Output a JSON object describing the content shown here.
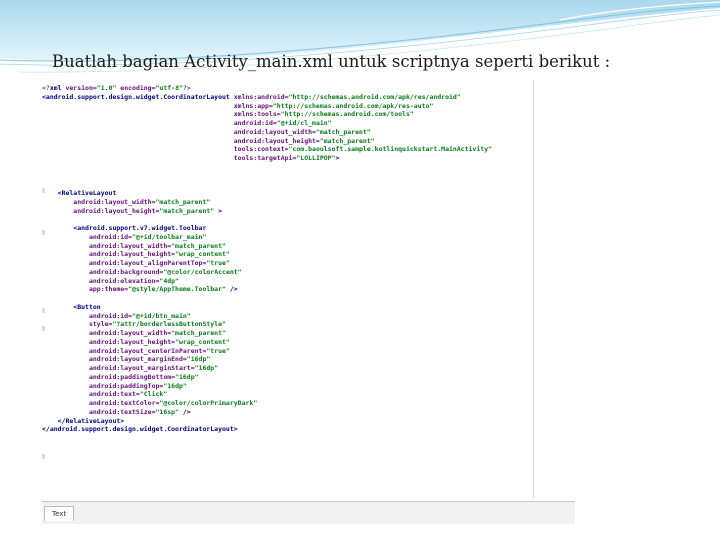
{
  "slide": {
    "title": "Buatlah bagian Activity_main.xml untuk scriptnya seperti berikut :"
  },
  "editor": {
    "bottom_tab_label": "Text",
    "code_lines": [
      [
        {
          "t": "<?",
          "c": "plain"
        },
        {
          "t": "xml ",
          "c": "tag"
        },
        {
          "t": "version=",
          "c": "attr"
        },
        {
          "t": "\"1.0\"",
          "c": "val"
        },
        {
          "t": " encoding=",
          "c": "attr"
        },
        {
          "t": "\"utf-8\"",
          "c": "val"
        },
        {
          "t": "?>",
          "c": "plain"
        }
      ],
      [
        {
          "t": "<android.support.design.widget.CoordinatorLayout ",
          "c": "tag"
        },
        {
          "t": "xmlns:android=",
          "c": "attr"
        },
        {
          "t": "\"http://schemas.android.com/apk/res/android\"",
          "c": "val"
        }
      ],
      [
        {
          "t": "                                                 xmlns:app=",
          "c": "attr"
        },
        {
          "t": "\"http://schemas.android.com/apk/res-auto\"",
          "c": "val"
        }
      ],
      [
        {
          "t": "                                                 xmlns:tools=",
          "c": "attr"
        },
        {
          "t": "\"http://schemas.android.com/tools\"",
          "c": "val"
        }
      ],
      [
        {
          "t": "                                                 android:id=",
          "c": "attr"
        },
        {
          "t": "\"@+id/cl_main\"",
          "c": "val"
        }
      ],
      [
        {
          "t": "                                                 android:layout_width=",
          "c": "attr"
        },
        {
          "t": "\"match_parent\"",
          "c": "val"
        }
      ],
      [
        {
          "t": "                                                 android:layout_height=",
          "c": "attr"
        },
        {
          "t": "\"match_parent\"",
          "c": "val"
        }
      ],
      [
        {
          "t": "                                                 tools:context=",
          "c": "attr"
        },
        {
          "t": "\"com.baoulsoft.sample.kotlinquickstart.MainActivity\"",
          "c": "val"
        }
      ],
      [
        {
          "t": "                                                 tools:targetApi=",
          "c": "attr"
        },
        {
          "t": "\"LOLLIPOP\"",
          "c": "val"
        },
        {
          "t": ">",
          "c": "tag"
        }
      ],
      [],
      [],
      [],
      [
        {
          "t": "    <RelativeLayout",
          "c": "tag"
        }
      ],
      [
        {
          "t": "        android:layout_width=",
          "c": "attr"
        },
        {
          "t": "\"match_parent\"",
          "c": "val"
        }
      ],
      [
        {
          "t": "        android:layout_height=",
          "c": "attr"
        },
        {
          "t": "\"match_parent\"",
          "c": "val"
        },
        {
          "t": " >",
          "c": "tag"
        }
      ],
      [],
      [
        {
          "t": "        <android.support.v7.widget.Toolbar",
          "c": "tag"
        }
      ],
      [
        {
          "t": "            android:id=",
          "c": "attr"
        },
        {
          "t": "\"@+id/toolbar_main\"",
          "c": "val"
        }
      ],
      [
        {
          "t": "            android:layout_width=",
          "c": "attr"
        },
        {
          "t": "\"match_parent\"",
          "c": "val"
        }
      ],
      [
        {
          "t": "            android:layout_height=",
          "c": "attr"
        },
        {
          "t": "\"wrap_content\"",
          "c": "val"
        }
      ],
      [
        {
          "t": "            android:layout_alignParentTop=",
          "c": "attr"
        },
        {
          "t": "\"true\"",
          "c": "val"
        }
      ],
      [
        {
          "t": "            android:background=",
          "c": "attr"
        },
        {
          "t": "\"@color/colorAccent\"",
          "c": "val"
        }
      ],
      [
        {
          "t": "            android:elevation=",
          "c": "attr"
        },
        {
          "t": "\"4dp\"",
          "c": "val"
        }
      ],
      [
        {
          "t": "            app:theme=",
          "c": "attr"
        },
        {
          "t": "\"@style/AppTheme.Toolbar\"",
          "c": "val"
        },
        {
          "t": " />",
          "c": "tag"
        }
      ],
      [],
      [
        {
          "t": "        <Button",
          "c": "tag"
        }
      ],
      [
        {
          "t": "            android:id=",
          "c": "attr"
        },
        {
          "t": "\"@+id/btn_main\"",
          "c": "val"
        }
      ],
      [
        {
          "t": "            style=",
          "c": "attr"
        },
        {
          "t": "\"?attr/borderlessButtonStyle\"",
          "c": "val"
        }
      ],
      [
        {
          "t": "            android:layout_width=",
          "c": "attr"
        },
        {
          "t": "\"match_parent\"",
          "c": "val"
        }
      ],
      [
        {
          "t": "            android:layout_height=",
          "c": "attr"
        },
        {
          "t": "\"wrap_content\"",
          "c": "val"
        }
      ],
      [
        {
          "t": "            android:layout_centerInParent=",
          "c": "attr"
        },
        {
          "t": "\"true\"",
          "c": "val"
        }
      ],
      [
        {
          "t": "            android:layout_marginEnd=",
          "c": "attr"
        },
        {
          "t": "\"16dp\"",
          "c": "val"
        }
      ],
      [
        {
          "t": "            android:layout_marginStart=",
          "c": "attr"
        },
        {
          "t": "\"16dp\"",
          "c": "val"
        }
      ],
      [
        {
          "t": "            android:paddingBottom=",
          "c": "attr"
        },
        {
          "t": "\"16dp\"",
          "c": "val"
        }
      ],
      [
        {
          "t": "            android:paddingTop=",
          "c": "attr"
        },
        {
          "t": "\"16dp\"",
          "c": "val"
        }
      ],
      [
        {
          "t": "            android:text=",
          "c": "attr"
        },
        {
          "t": "\"Click\"",
          "c": "val"
        }
      ],
      [
        {
          "t": "            android:textColor=",
          "c": "attr"
        },
        {
          "t": "\"@color/colorPrimaryDark\"",
          "c": "val"
        }
      ],
      [
        {
          "t": "            android:textSize=",
          "c": "attr"
        },
        {
          "t": "\"16sp\"",
          "c": "val"
        },
        {
          "t": " />",
          "c": "tag"
        }
      ],
      [
        {
          "t": "    </RelativeLayout>",
          "c": "tag"
        }
      ],
      [
        {
          "t": "</android.support.design.widget.CoordinatorLayout>",
          "c": "tag"
        }
      ]
    ]
  }
}
